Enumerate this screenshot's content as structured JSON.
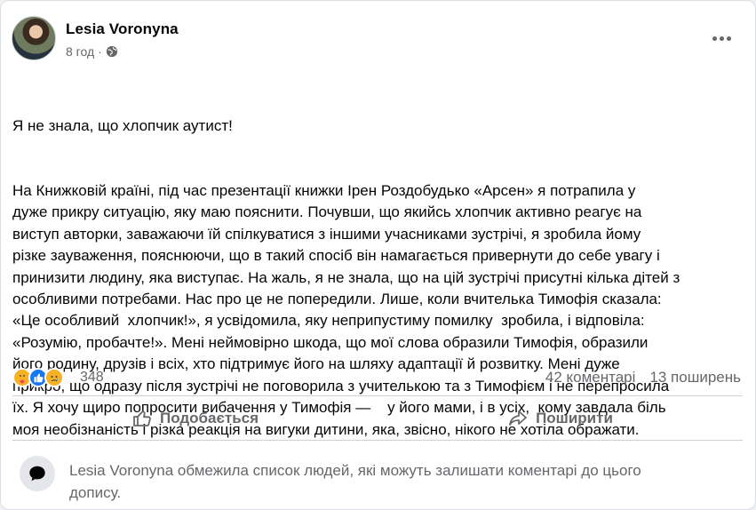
{
  "post": {
    "author": "Lesia Voronyna",
    "time": "8 год",
    "separator": "·",
    "paragraphs": [
      "Я не знала, що хлопчик аутист!",
      "На Книжковій країні, під час презентації книжки Ірен Роздобудько «Арсен» я потрапила у\nдуже прикру ситуацію, яку маю пояснити. Почувши, що якийсь хлопчик активно реагує на\nвиступ авторки, заважаючи їй спілкуватися з іншими учасниками зустрічі, я зробила йому\nрізке зауваження, пояснюючи, що в такий спосіб він намагається привернути до себе увагу і\nпринизити людину, яка виступає. На жаль, я не знала, що на цій зустрічі присутні кілька дітей з\nособливими потребами. Нас про це не попередили. Лише, коли вчителька Тимофія сказала:\n«Це особливий  хлопчик!», я усвідомила, яку неприпустиму помилку  зробила, і відповіла:\n«Розумію, пробачте!». Мені неймовірно шкода, що мої слова образили Тимофія, образили\nйого родину, друзів і всіх, хто підтримує його на шляху адаптації й розвитку. Мені дуже\nприкро, що одразу після зустрічі не поговорила з учителькою та з Тимофієм і не перепросила\nїх. Я хочу щиро попросити вибачення у Тимофія —    у його мами, і в усіх,  кому завдала біль\nмоя необізнаність і різка реакція на вигуки дитини, яка, звісно, нікого не хотіла ображати."
    ]
  },
  "stats": {
    "reaction_count": "348",
    "comments": "42 коментарі",
    "shares": "13 поширень"
  },
  "actions": {
    "like_label": "Подобається",
    "share_label": "Поширити"
  },
  "notice": {
    "text": "Lesia Voronyna обмежила список людей, які можуть залишати коментарі до цього\nдопису."
  },
  "icons": {
    "reactions": [
      "care-reaction-icon",
      "like-reaction-icon",
      "sad-reaction-icon"
    ],
    "more": "more-options-icon",
    "privacy": "globe-icon",
    "like": "thumbs-up-icon",
    "share": "share-arrow-icon",
    "notice": "comment-bubble-icon"
  },
  "colors": {
    "secondary_text": "#65676b",
    "like_blue": "#1877f2",
    "reaction_yellow": "#f7b125"
  }
}
